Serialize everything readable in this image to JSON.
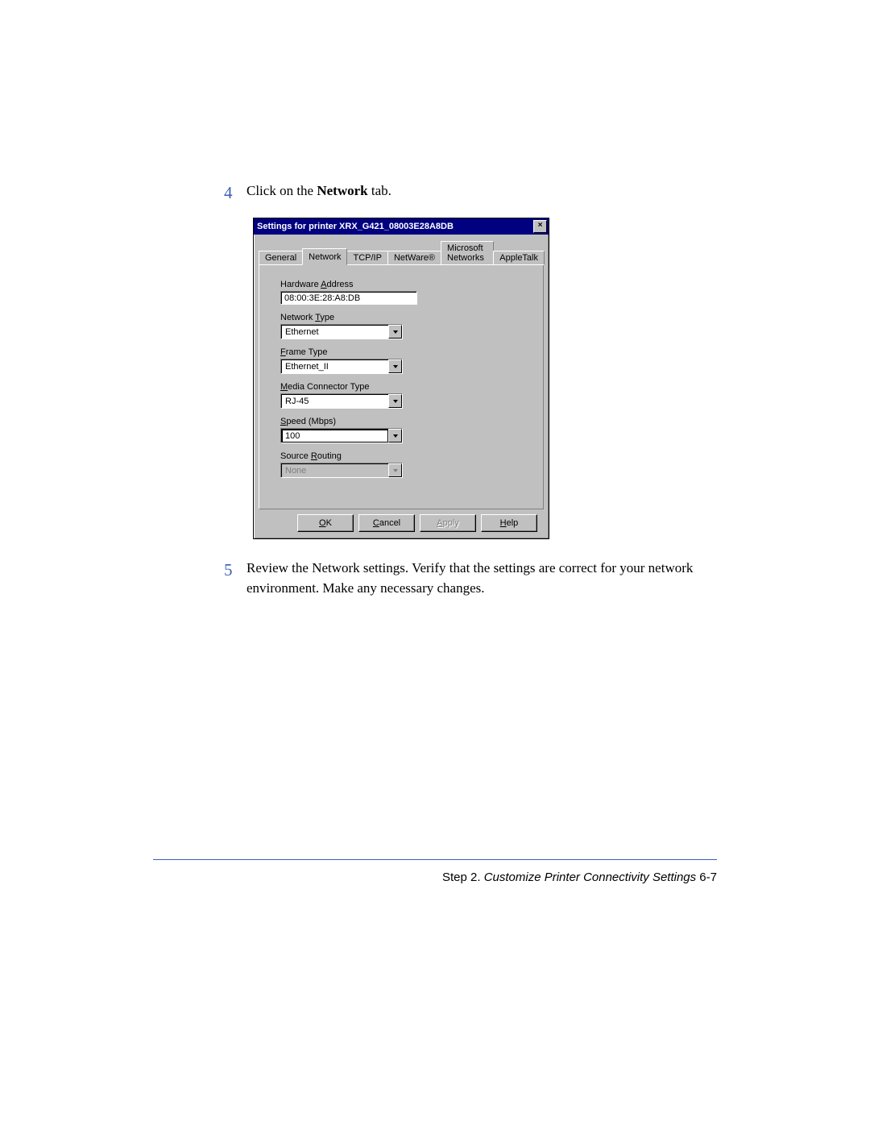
{
  "step4": {
    "num": "4",
    "prefix": "Click on the ",
    "bold": "Network",
    "suffix": " tab."
  },
  "step5": {
    "num": "5",
    "text": "Review the Network settings. Verify that the settings are correct for your network environment. Make any necessary changes."
  },
  "dialog": {
    "title": "Settings for printer XRX_G421_08003E28A8DB",
    "close": "×",
    "tabs": {
      "general": "General",
      "network": "Network",
      "tcpip": "TCP/IP",
      "netware": "NetWare®",
      "msnet": "Microsoft Networks",
      "appletalk": "AppleTalk"
    },
    "fields": {
      "hw_prefix": "Hardware ",
      "hw_u": "A",
      "hw_suffix": "ddress",
      "hw_value": "08:00:3E:28:A8:DB",
      "nt_prefix": "Network ",
      "nt_u": "T",
      "nt_suffix": "ype",
      "nt_value": "Ethernet",
      "ft_u": "F",
      "ft_suffix": "rame Type",
      "ft_value": "Ethernet_II",
      "mc_u": "M",
      "mc_suffix": "edia Connector Type",
      "mc_value": "RJ-45",
      "sp_u": "S",
      "sp_suffix": "peed (Mbps)",
      "sp_value": "100",
      "sr_prefix": "Source ",
      "sr_u": "R",
      "sr_suffix": "outing",
      "sr_value": "None"
    },
    "buttons": {
      "ok_u": "O",
      "ok_suffix": "K",
      "cancel_u": "C",
      "cancel_suffix": "ancel",
      "apply_u": "A",
      "apply_suffix": "pply",
      "help_u": "H",
      "help_suffix": "elp"
    }
  },
  "footer": {
    "prefix": "Step 2. ",
    "italic": "Customize Printer Connectivity Settings",
    "pagenum": "   6-7"
  }
}
